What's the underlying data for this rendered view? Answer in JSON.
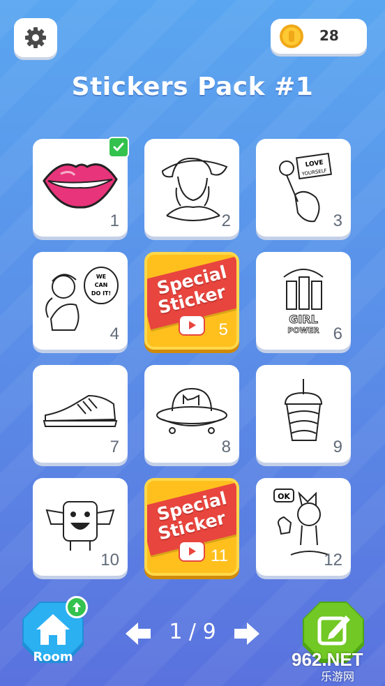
{
  "header": {
    "settings_icon": "gear-icon",
    "coin_icon": "coin-icon",
    "coin_count": "28"
  },
  "title": "Stickers Pack #1",
  "stickers": [
    {
      "number": "1",
      "type": "lips",
      "completed": true
    },
    {
      "number": "2",
      "type": "woman-hat"
    },
    {
      "number": "3",
      "type": "love-yourself-hand"
    },
    {
      "number": "4",
      "type": "we-can-do-it"
    },
    {
      "number": "5",
      "type": "special",
      "line1": "Special",
      "line2": "Sticker"
    },
    {
      "number": "6",
      "type": "girl-power"
    },
    {
      "number": "7",
      "type": "sneaker"
    },
    {
      "number": "8",
      "type": "ufo-cat"
    },
    {
      "number": "9",
      "type": "drink-cup"
    },
    {
      "number": "10",
      "type": "monster"
    },
    {
      "number": "11",
      "type": "special",
      "line1": "Special",
      "line2": "Sticker"
    },
    {
      "number": "12",
      "type": "ok-cat"
    }
  ],
  "sticker_art_text": {
    "love_yourself": "LOVE YOURSELF",
    "we_can_do_it": "WE CAN DO IT!",
    "girl_power_1": "GIRL",
    "girl_power_2": "POWER",
    "ok": "OK"
  },
  "footer": {
    "room_label": "Room",
    "page_indicator": "1 / 9",
    "prev_icon": "arrow-left-icon",
    "next_icon": "arrow-right-icon",
    "edit_icon": "edit-icon"
  },
  "watermark": {
    "top": "962.NET",
    "bottom": "乐游网"
  },
  "colors": {
    "background_top": "#5aa6f0",
    "background_bottom": "#5a72de",
    "special_card": "#ffc01e",
    "special_banner": "#e8453e",
    "completed_check": "#33c24d",
    "room_button": "#28a8ef",
    "edit_button": "#6cc21f"
  }
}
